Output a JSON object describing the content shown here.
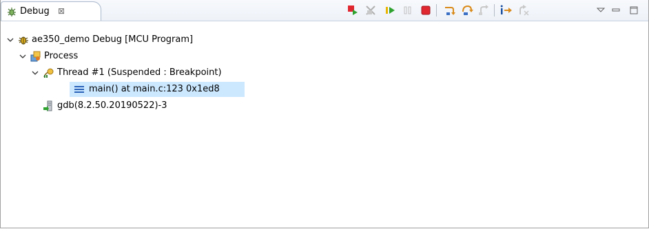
{
  "tab": {
    "label": "Debug",
    "close_glyph": "⊠",
    "icon": "debug-bug-icon"
  },
  "toolbar": {
    "items": [
      {
        "name": "connect-icon",
        "icon": "connect"
      },
      {
        "name": "terminate-and-remove-icon",
        "icon": "remove-terminated"
      },
      {
        "name": "resume-icon",
        "icon": "resume"
      },
      {
        "name": "suspend-icon",
        "icon": "suspend"
      },
      {
        "name": "terminate-icon",
        "icon": "terminate"
      },
      {
        "name": "step-into-icon",
        "icon": "step-into"
      },
      {
        "name": "step-over-icon",
        "icon": "step-over"
      },
      {
        "name": "step-return-icon",
        "icon": "step-return"
      },
      {
        "name": "instruction-stepping-icon",
        "icon": "instruction-step"
      },
      {
        "name": "drop-to-frame-icon",
        "icon": "drop-to-frame"
      },
      {
        "name": "view-menu-icon",
        "icon": "view-menu"
      },
      {
        "name": "minimize-icon",
        "icon": "minimize"
      },
      {
        "name": "maximize-icon",
        "icon": "maximize"
      }
    ]
  },
  "tree": {
    "launch": {
      "label": "ae350_demo Debug [MCU Program]",
      "icon": "launch-bug-icon",
      "expanded": true
    },
    "process": {
      "label": "Process",
      "icon": "process-icon",
      "expanded": true
    },
    "thread": {
      "label": "Thread #1 (Suspended : Breakpoint)",
      "icon": "thread-suspended-icon",
      "expanded": true
    },
    "frame": {
      "label": "main() at main.c:123 0x1ed8",
      "icon": "stack-frame-icon",
      "selected": true
    },
    "gdb": {
      "label": "gdb(8.2.50.20190522)-3",
      "icon": "gdb-process-icon"
    }
  },
  "colors": {
    "selection": "#cce8ff",
    "terminate_red": "#e0262f",
    "resume_green": "#2ea22e",
    "step_orange": "#d98a1a"
  }
}
